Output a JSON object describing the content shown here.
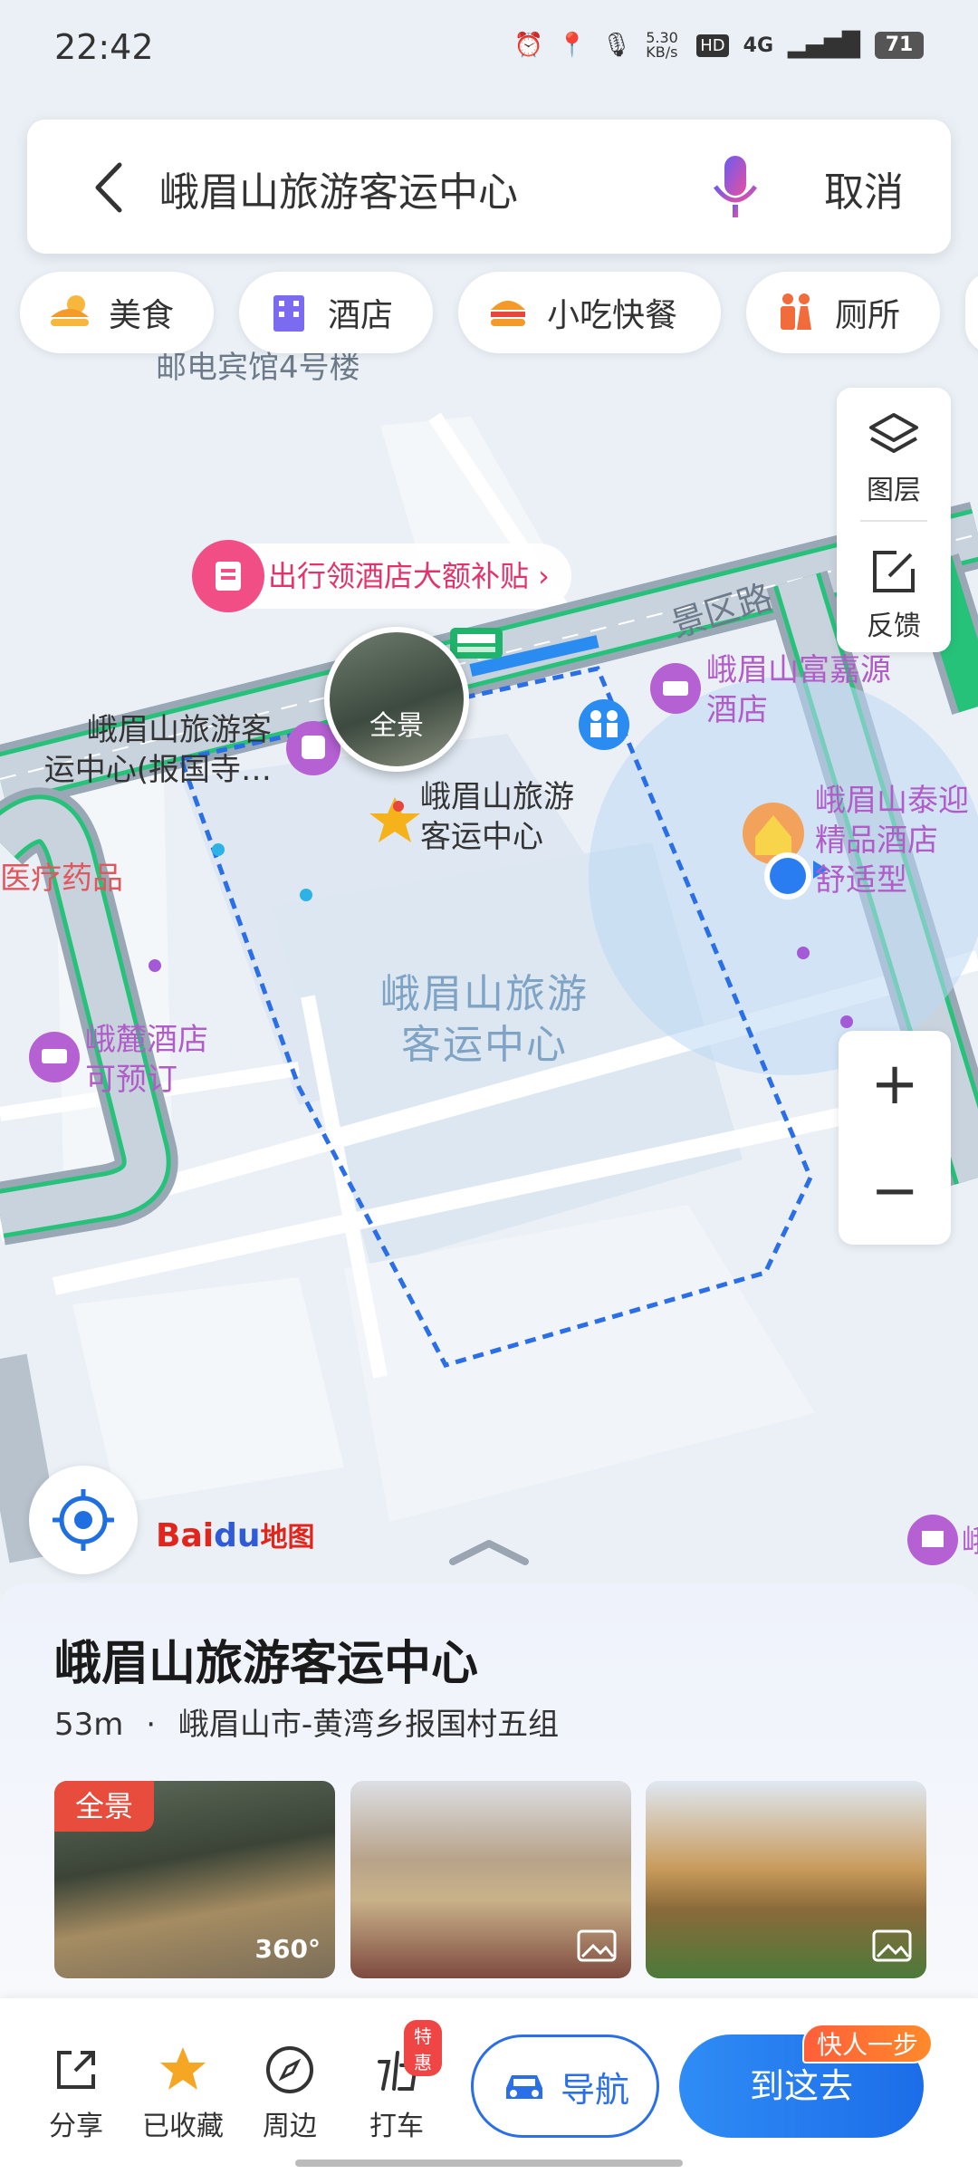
{
  "status_bar": {
    "time": "22:42",
    "net_speed": "5.30 KB/s",
    "hd": "HD",
    "network": "4G",
    "battery": "71"
  },
  "search": {
    "query": "峨眉山旅游客运中心",
    "cancel_label": "取消"
  },
  "categories": [
    {
      "label": "美食",
      "icon": "burger-sun-icon"
    },
    {
      "label": "酒店",
      "icon": "hotel-icon"
    },
    {
      "label": "小吃快餐",
      "icon": "burger-icon"
    },
    {
      "label": "厕所",
      "icon": "toilet-icon"
    }
  ],
  "map_tools": {
    "layers_label": "图层",
    "feedback_label": "反馈",
    "zoom_in": "+",
    "zoom_out": "−"
  },
  "map_labels": {
    "top_building": "邮电宾馆4号楼",
    "promo": "出行领酒店大额补贴 ›",
    "road": "景区路",
    "hotel_fujiayuan": "峨眉山富嘉源\n酒店",
    "station_left": "峨眉山旅游客\n运中心(报国寺…",
    "poi_name": "峨眉山旅游\n客运中心",
    "hotel_taiyi": "峨眉山泰迎\n精品酒店\n舒适型",
    "medical": "医疗药品",
    "area_name": "峨眉山旅游\n客运中心",
    "hotel_elu": "峨麓酒店\n可预订",
    "panorama": "全景",
    "far_right": "峨"
  },
  "logo": {
    "bai": "Bai",
    "du": "du",
    "ditu": "地图"
  },
  "place": {
    "title": "峨眉山旅游客运中心",
    "distance": "53m",
    "separator": "·",
    "address": "峨眉山市-黄湾乡报国村五组",
    "photos": [
      {
        "tag": "全景",
        "badge": "360°"
      },
      {
        "tag": "",
        "badge": ""
      },
      {
        "tag": "",
        "badge": ""
      }
    ]
  },
  "actions": [
    {
      "label": "分享",
      "icon": "share-icon"
    },
    {
      "label": "已收藏",
      "icon": "star-icon"
    },
    {
      "label": "周边",
      "icon": "compass-icon"
    },
    {
      "label": "打车",
      "icon": "taxi-icon",
      "badge": "特惠"
    }
  ],
  "nav_label": "导航",
  "go_label": "到这去",
  "go_badge": "快人一步",
  "colors": {
    "accent": "#2a6ee8",
    "road_green": "#27c27a",
    "area_outline": "#2a6ee8",
    "promo": "#e2336b"
  }
}
